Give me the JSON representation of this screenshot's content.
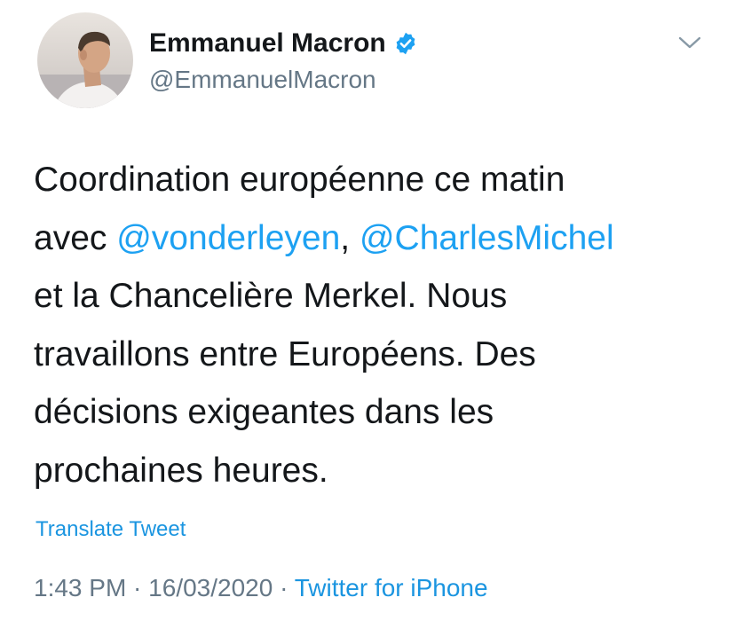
{
  "author": {
    "display_name": "Emmanuel Macron",
    "handle": "@EmmanuelMacron",
    "verified_icon": "verified-badge-icon",
    "avatar": "profile-photo"
  },
  "header": {
    "more_icon": "chevron-down-icon"
  },
  "tweet": {
    "line1": "Coordination européenne ce matin",
    "line2_prefix": "avec ",
    "mention1": "@vonderleyen",
    "line2_sep": ", ",
    "mention2": "@CharlesMichel",
    "line3": "et la Chancelière Merkel. Nous",
    "line4": "travaillons entre Européens. Des",
    "line5": "décisions exigeantes dans les",
    "line6": "prochaines heures."
  },
  "translate_label": "Translate Tweet",
  "meta": {
    "time": "1:43 PM",
    "separator1": " · ",
    "date": "16/03/2020",
    "separator2": " · ",
    "source": "Twitter for iPhone"
  },
  "colors": {
    "link": "#1da1f2",
    "secondary_text": "#657786",
    "primary_text": "#14171a"
  }
}
